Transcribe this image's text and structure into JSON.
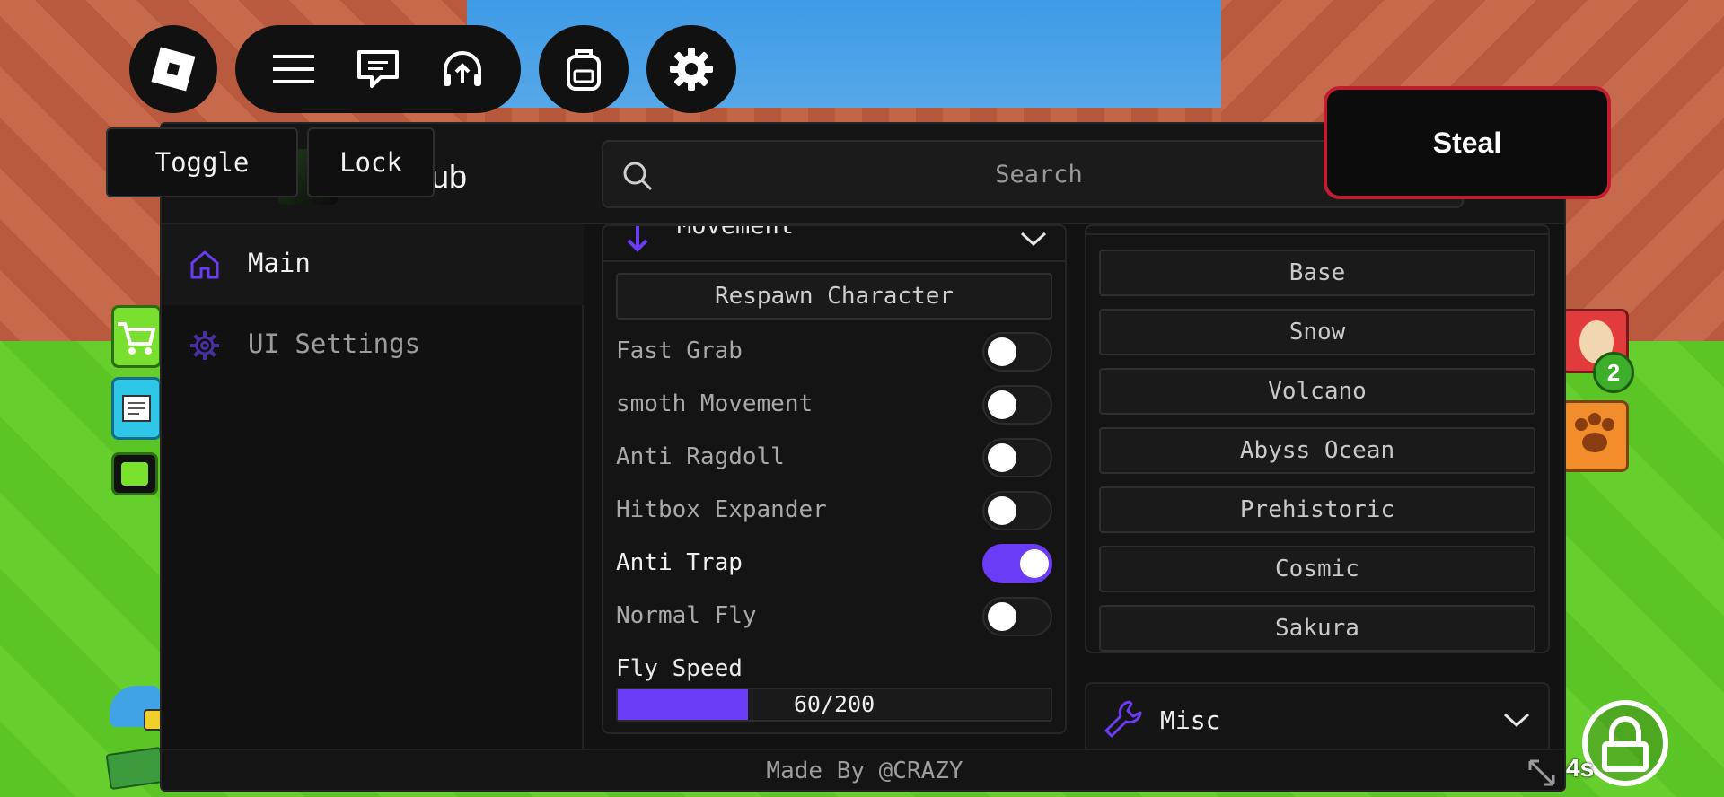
{
  "window": {
    "title": "ub"
  },
  "top_bar": {
    "icons": [
      "roblox-logo-icon",
      "menu-icon",
      "chat-icon",
      "headset-icon",
      "backpack-icon",
      "gear-icon"
    ]
  },
  "overlay": {
    "toggle_label": "Toggle",
    "lock_label": "Lock"
  },
  "steal_button": {
    "label": "Steal"
  },
  "search": {
    "placeholder": "Search"
  },
  "sidebar": {
    "items": [
      {
        "label": "Main",
        "icon": "home-icon",
        "active": true
      },
      {
        "label": "UI Settings",
        "icon": "gear-icon",
        "active": false
      }
    ]
  },
  "movement": {
    "title": "Movement",
    "respawn_label": "Respawn Character",
    "toggles": [
      {
        "label": "Fast Grab",
        "on": false
      },
      {
        "label": "smoth Movement",
        "on": false
      },
      {
        "label": "Anti Ragdoll",
        "on": false
      },
      {
        "label": "Hitbox Expander",
        "on": false
      },
      {
        "label": "Anti Trap",
        "on": true
      },
      {
        "label": "Normal Fly",
        "on": false
      }
    ],
    "fly_speed": {
      "label": "Fly Speed",
      "value": 60,
      "max": 200,
      "text": "60/200"
    }
  },
  "bases": {
    "items": [
      "Base",
      "Snow",
      "Volcano",
      "Abyss Ocean",
      "Prehistoric",
      "Cosmic",
      "Sakura"
    ]
  },
  "misc": {
    "label": "Misc",
    "icon": "wrench-icon"
  },
  "footer": {
    "text": "Made By @CRAZY"
  },
  "game_hud": {
    "badge_count": "2",
    "timer": "4s"
  },
  "colors": {
    "accent": "#6b3cf5",
    "panel_bg": "#121212",
    "steal_border": "#c01e2e"
  }
}
